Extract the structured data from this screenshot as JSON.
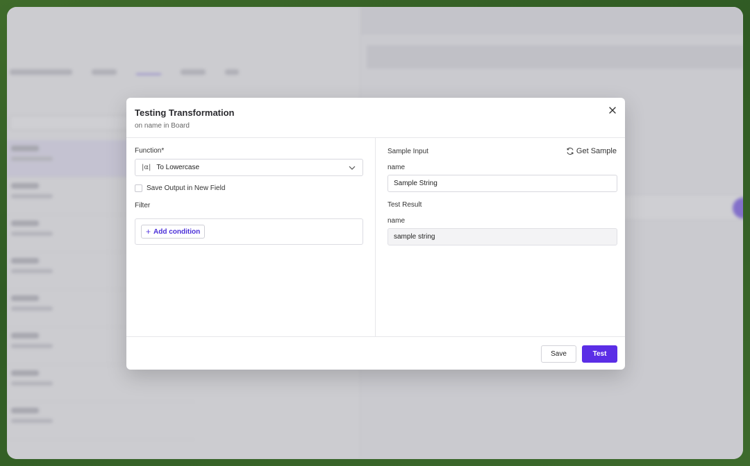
{
  "modal": {
    "title": "Testing Transformation",
    "subtitle": "on name in Board",
    "close_icon": "close-icon"
  },
  "left": {
    "function_label": "Function*",
    "function_value": "To Lowercase",
    "function_icon": "text-function-icon",
    "save_output_label": "Save Output in New Field",
    "save_output_checked": false,
    "filter_label": "Filter",
    "add_condition_label": "Add condition"
  },
  "right": {
    "sample_input_label": "Sample Input",
    "get_sample_label": "Get Sample",
    "input_field_name": "name",
    "input_value": "Sample String",
    "test_result_label": "Test Result",
    "result_field_name": "name",
    "result_value": "sample string"
  },
  "footer": {
    "save_label": "Save",
    "test_label": "Test"
  },
  "colors": {
    "primary": "#5b2ee6",
    "link": "#4a2fd8"
  }
}
